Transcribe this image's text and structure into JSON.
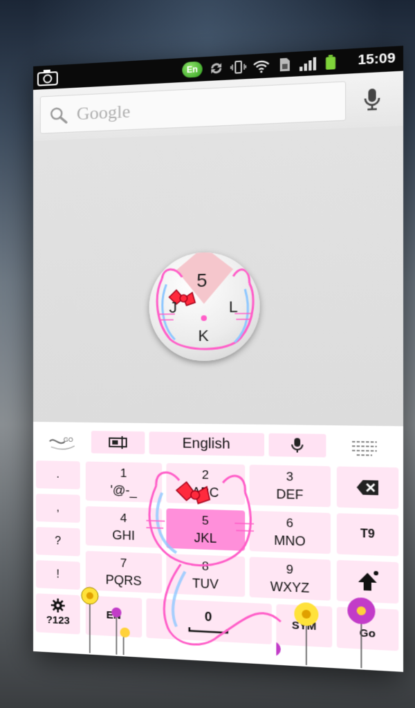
{
  "status_bar": {
    "input_badge": "En",
    "time": "15:09"
  },
  "search": {
    "placeholder": "Google"
  },
  "popup": {
    "top": "5",
    "left": "J",
    "right": "L",
    "bottom": "K"
  },
  "keyboard": {
    "language": "English",
    "punct_keys": [
      ".",
      ",",
      "?",
      "!"
    ],
    "keys": [
      {
        "num": "1",
        "letters": "'@-_"
      },
      {
        "num": "2",
        "letters": "ABC"
      },
      {
        "num": "3",
        "letters": "DEF"
      },
      {
        "num": "4",
        "letters": "GHI"
      },
      {
        "num": "5",
        "letters": "JKL"
      },
      {
        "num": "6",
        "letters": "MNO"
      },
      {
        "num": "7",
        "letters": "PQRS"
      },
      {
        "num": "8",
        "letters": "TUV"
      },
      {
        "num": "9",
        "letters": "WXYZ"
      }
    ],
    "t9": "T9",
    "num_mode": "?123",
    "lang_key": "EN",
    "space_num": "0",
    "sym": "SYM",
    "go": "Go"
  },
  "colors": {
    "key_bg": "#ffe6f4",
    "key_selected": "#ff8fda",
    "status_bar": "#0a0a0a"
  }
}
